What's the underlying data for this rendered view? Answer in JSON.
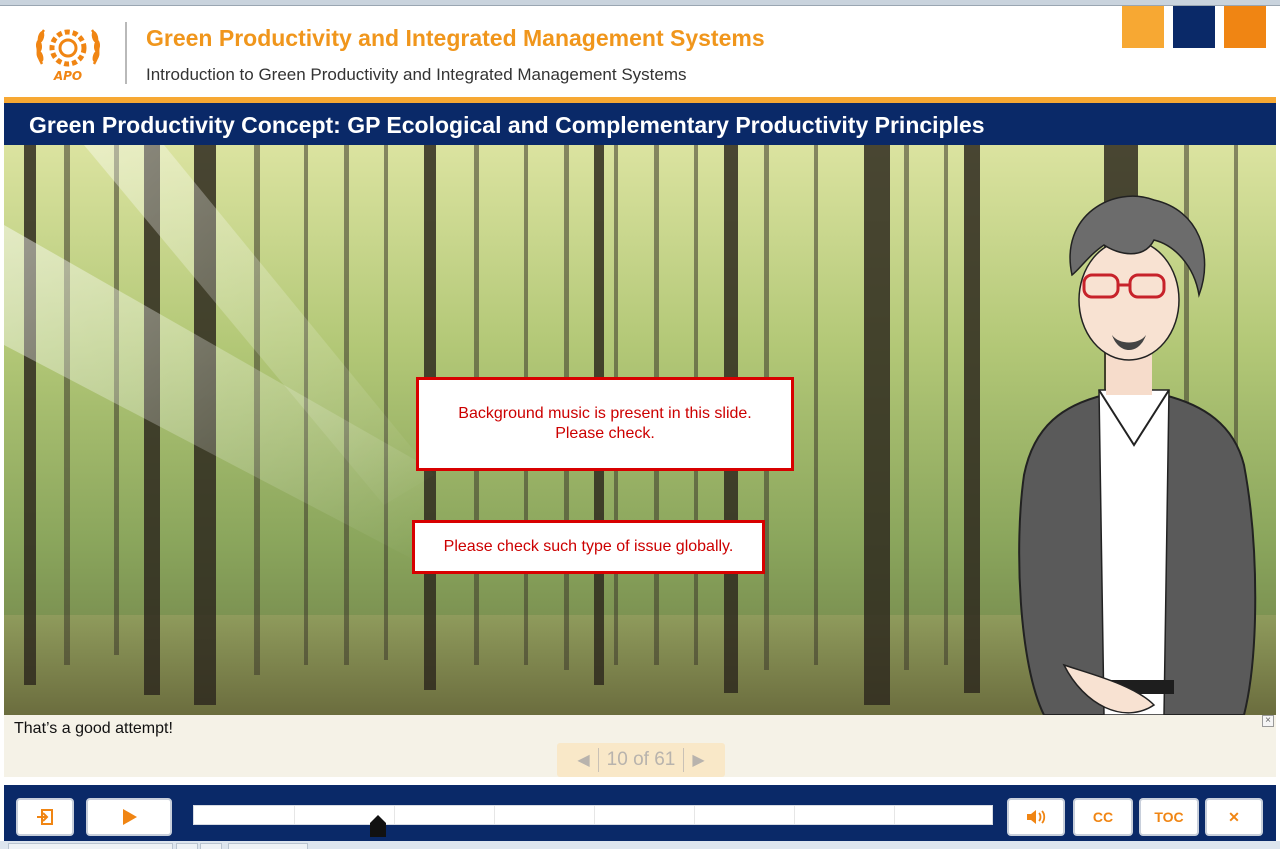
{
  "window": {
    "expand_glyph": "»"
  },
  "header": {
    "course_title": "Green Productivity and Integrated Management Systems",
    "course_subtitle": "Introduction to Green Productivity and Integrated Management Systems",
    "logo_text": "APO",
    "brand_colors": [
      "#f7a833",
      "#0a2968",
      "#f08513"
    ]
  },
  "slide": {
    "title": "Green Productivity Concept: GP Ecological and Complementary Productivity Principles"
  },
  "notes": [
    {
      "line1": "Background music is present in this slide.",
      "line2": "Please check."
    },
    {
      "line1": "Please check such type of issue globally."
    }
  ],
  "caption": {
    "text": "That’s a good attempt!",
    "close_glyph": "×"
  },
  "pager": {
    "prev_glyph": "◀",
    "label": "10 of 61",
    "next_glyph": "▶"
  },
  "controls": {
    "exit_icon": "exit-icon",
    "play_icon": "play-icon",
    "audio_icon": "speaker-icon",
    "cc_label": "CC",
    "toc_label": "TOC",
    "close_glyph": "✕",
    "accent_color": "#f08513",
    "bar_color": "#0a2968"
  },
  "colors": {
    "note_border": "#d80000",
    "note_text": "#cc0000",
    "title_bar": "#0a2968",
    "title_text": "#ffffff",
    "course_title": "#f0961c"
  }
}
